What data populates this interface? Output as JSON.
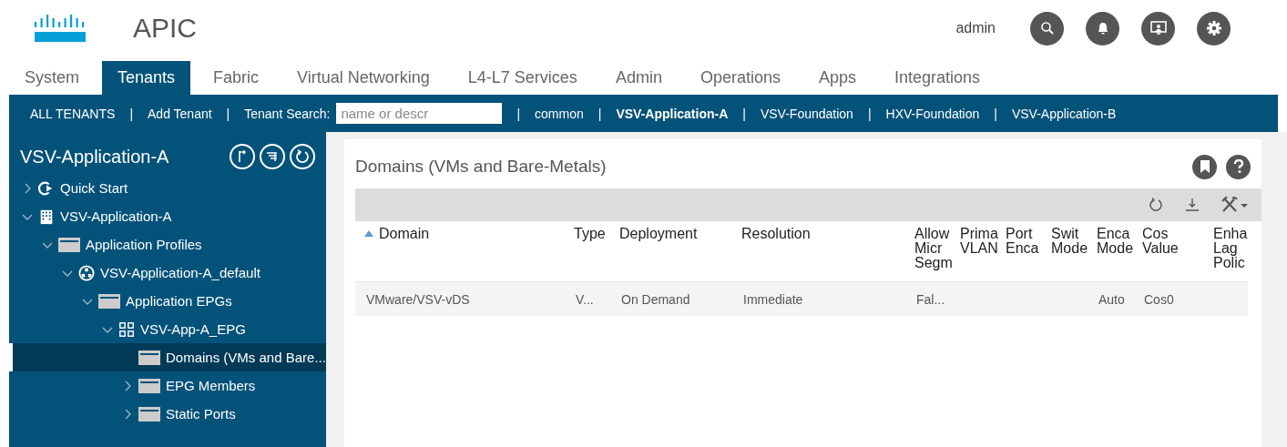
{
  "header": {
    "product": "APIC",
    "user": "admin"
  },
  "tabs": [
    {
      "label": "System",
      "selected": false
    },
    {
      "label": "Tenants",
      "selected": true
    },
    {
      "label": "Fabric",
      "selected": false
    },
    {
      "label": "Virtual Networking",
      "selected": false
    },
    {
      "label": "L4-L7 Services",
      "selected": false
    },
    {
      "label": "Admin",
      "selected": false
    },
    {
      "label": "Operations",
      "selected": false
    },
    {
      "label": "Apps",
      "selected": false
    },
    {
      "label": "Integrations",
      "selected": false
    }
  ],
  "subnav": {
    "links": [
      {
        "label": "ALL TENANTS",
        "selected": false,
        "separator": "|"
      },
      {
        "label": "Add Tenant",
        "selected": false,
        "separator": "|"
      }
    ],
    "search_label": "Tenant Search:",
    "search_placeholder": "name or descr",
    "tenants": [
      {
        "label": "common",
        "selected": false,
        "separator": "|"
      },
      {
        "label": "VSV-Application-A",
        "selected": true,
        "separator": "|"
      },
      {
        "label": "VSV-Foundation",
        "selected": false,
        "separator": "|"
      },
      {
        "label": "HXV-Foundation",
        "selected": false,
        "separator": "|"
      },
      {
        "label": "VSV-Application-B",
        "selected": false,
        "separator": "|"
      }
    ]
  },
  "sidebar": {
    "title": "VSV-Application-A",
    "tree": [
      {
        "label": "Quick Start",
        "kind": "quickstart",
        "expanded": false,
        "selected": false
      },
      {
        "label": "VSV-Application-A",
        "kind": "tenant",
        "expanded": true,
        "selected": false,
        "children": [
          {
            "label": "Application Profiles",
            "kind": "folder",
            "expanded": true,
            "selected": false,
            "children": [
              {
                "label": "VSV-Application-A_default",
                "kind": "profile",
                "expanded": true,
                "selected": false,
                "children": [
                  {
                    "label": "Application EPGs",
                    "kind": "folder",
                    "expanded": true,
                    "selected": false,
                    "children": [
                      {
                        "label": "VSV-App-A_EPG",
                        "kind": "epg",
                        "expanded": true,
                        "selected": false,
                        "children": [
                          {
                            "label": "Domains (VMs and Bare...",
                            "kind": "folder",
                            "selected": true
                          },
                          {
                            "label": "EPG Members",
                            "kind": "folder",
                            "expanded": false,
                            "selected": false
                          },
                          {
                            "label": "Static Ports",
                            "kind": "folder",
                            "expanded": false,
                            "selected": false
                          }
                        ]
                      }
                    ]
                  }
                ]
              }
            ]
          }
        ]
      }
    ]
  },
  "panel": {
    "title": "Domains (VMs and Bare-Metals)",
    "columns": [
      {
        "lines": [
          "Domain"
        ],
        "sorted": true
      },
      {
        "lines": [
          "Type"
        ],
        "sorted": false
      },
      {
        "lines": [
          "Deployment"
        ],
        "sorted": false
      },
      {
        "lines": [
          "Resolution"
        ],
        "sorted": false
      },
      {
        "lines": [
          "Allow",
          "Micr",
          "Segm"
        ],
        "sorted": false
      },
      {
        "lines": [
          "Prima",
          "VLAN"
        ],
        "sorted": false
      },
      {
        "lines": [
          "Port",
          "Enca"
        ],
        "sorted": false
      },
      {
        "lines": [
          "Swit",
          "Mode"
        ],
        "sorted": false
      },
      {
        "lines": [
          "Enca",
          "Mode"
        ],
        "sorted": false
      },
      {
        "lines": [
          "Cos",
          "Value"
        ],
        "sorted": false
      },
      {
        "lines": [
          "Enha",
          "Lag",
          "Polic"
        ],
        "sorted": false
      }
    ],
    "rows": [
      [
        "VMware/VSV-vDS",
        "V...",
        "On Demand",
        "Immediate",
        "Fal...",
        "",
        "",
        "",
        "Auto",
        "Cos0",
        ""
      ]
    ]
  }
}
